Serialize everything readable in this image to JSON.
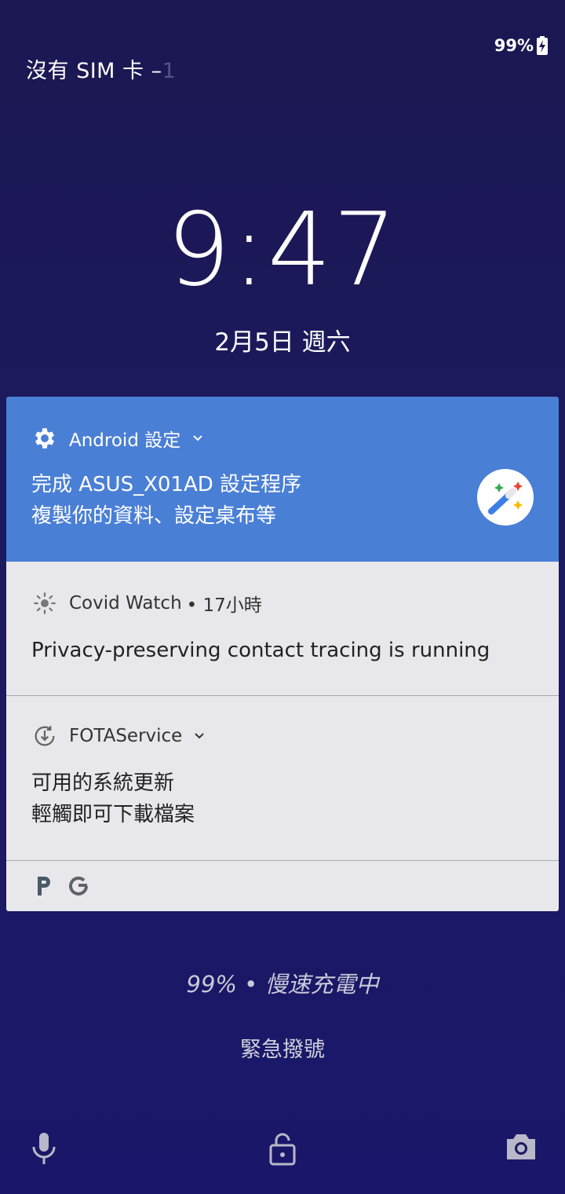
{
  "status_bar": {
    "carrier": "沒有 SIM 卡 –",
    "carrier_fade": "1",
    "battery": "99%"
  },
  "lockscreen": {
    "time": "9:47",
    "date": "2月5日 週六"
  },
  "notifications": [
    {
      "app": "Android 設定",
      "title": "完成 ASUS_X01AD 設定程序",
      "text": "複製你的資料、設定桌布等",
      "icon": "gear-icon",
      "large_icon": "magic-wand-icon"
    },
    {
      "app": "Covid Watch",
      "time": "• 17小時",
      "title": "Privacy-preserving contact tracing is running",
      "icon": "sun-icon"
    },
    {
      "app": "FOTAService",
      "title": "可用的系統更新",
      "text": "輕觸即可下載檔案",
      "icon": "update-icon"
    }
  ],
  "overflow_icons": [
    "p-app-icon",
    "google-icon"
  ],
  "footer": {
    "charging": "99% • 慢速充電中",
    "emergency": "緊急撥號"
  },
  "colors": {
    "background": "#1c1a5e",
    "notification_accent": "#4a7fd6",
    "notification_card": "#e8e8ec"
  },
  "bottom_actions": [
    "microphone-icon",
    "lock-icon",
    "camera-icon"
  ]
}
